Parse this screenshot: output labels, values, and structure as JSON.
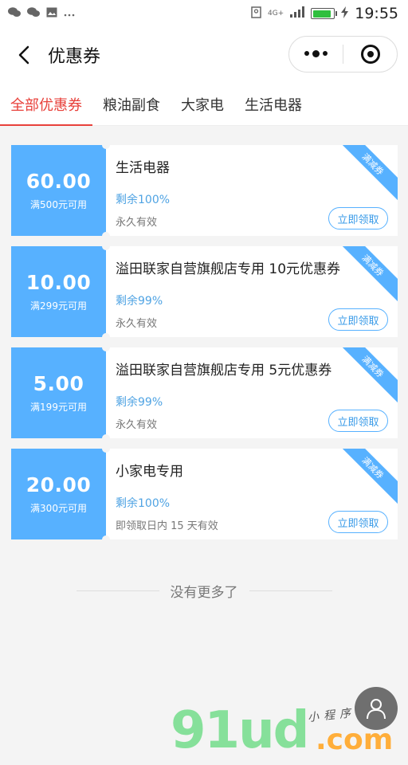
{
  "status_bar": {
    "time": "19:55",
    "network": "4G+",
    "battery_percent": 90,
    "left_icons": [
      "wechat-icon",
      "wechat-icon",
      "image-icon",
      "more-icon"
    ],
    "right_icons": [
      "location-icon",
      "signal-icon",
      "charging-icon"
    ]
  },
  "nav": {
    "title": "优惠券",
    "back_icon": "chevron-left-icon",
    "menu_icon": "more-dots-icon",
    "close_icon": "target-icon"
  },
  "tabs": [
    {
      "label": "全部优惠券",
      "active": true
    },
    {
      "label": "粮油副食",
      "active": false
    },
    {
      "label": "大家电",
      "active": false
    },
    {
      "label": "生活电器",
      "active": false
    }
  ],
  "coupons": [
    {
      "amount": "60.00",
      "threshold": "满500元可用",
      "name": "生活电器",
      "remain": "剩余100%",
      "validity": "永久有效",
      "button": "立即领取",
      "ribbon": "满减券"
    },
    {
      "amount": "10.00",
      "threshold": "满299元可用",
      "name": "溢田联家自营旗舰店专用 10元优惠券",
      "remain": "剩余99%",
      "validity": "永久有效",
      "button": "立即领取",
      "ribbon": "满减券"
    },
    {
      "amount": "5.00",
      "threshold": "满199元可用",
      "name": "溢田联家自营旗舰店专用 5元优惠券",
      "remain": "剩余99%",
      "validity": "永久有效",
      "button": "立即领取",
      "ribbon": "满减券"
    },
    {
      "amount": "20.00",
      "threshold": "满300元可用",
      "name": "小家电专用",
      "remain": "剩余100%",
      "validity": "即领取日内 15 天有效",
      "button": "立即领取",
      "ribbon": "满减券"
    }
  ],
  "end_text": "没有更多了",
  "fab_icon": "user-icon",
  "watermark": {
    "main": "91ud",
    "suffix": ".com",
    "small": "小程序"
  },
  "colors": {
    "accent": "#e8413b",
    "coupon_blue": "#57b1ff",
    "remain_blue": "#4fa3e3"
  }
}
